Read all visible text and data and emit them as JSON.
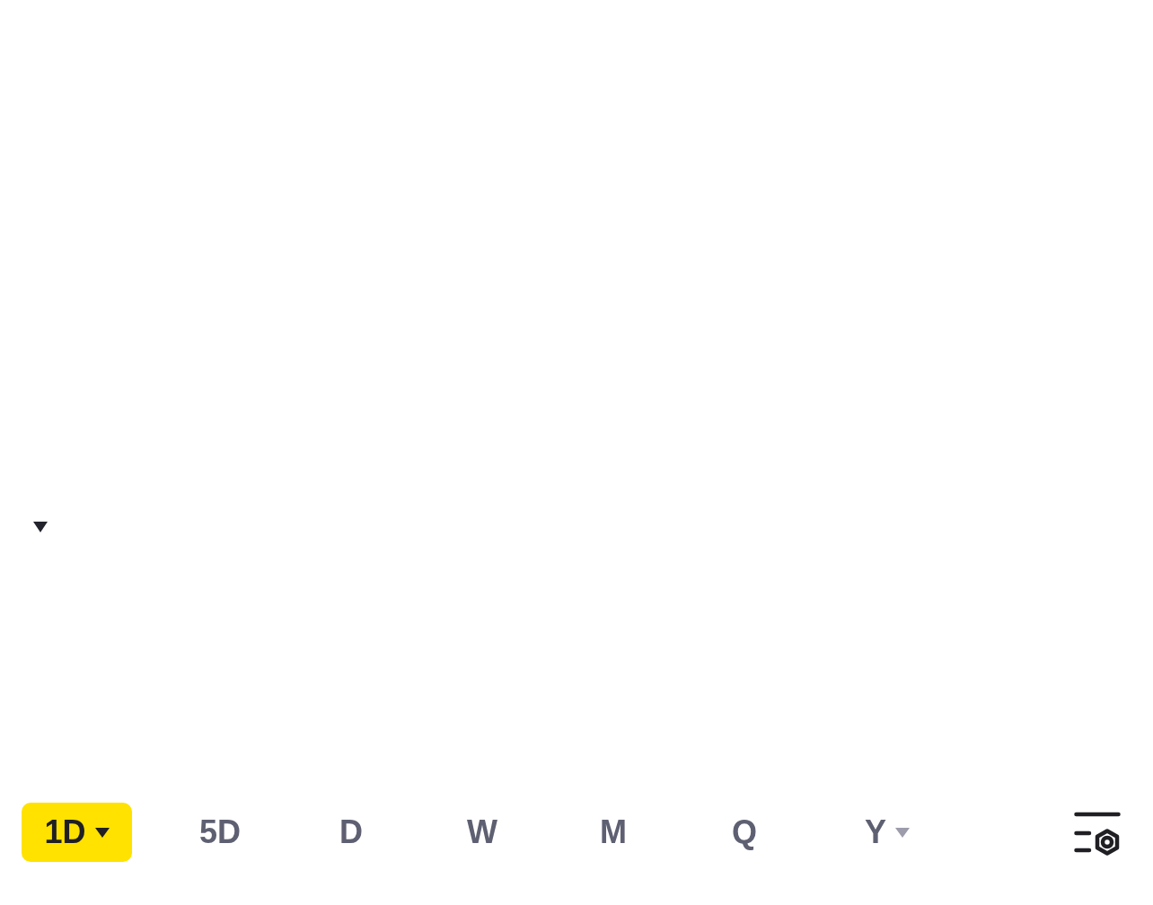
{
  "timeframe_tabs": [
    {
      "label": "1D",
      "selected": true,
      "dropdown": true
    },
    {
      "label": "5D",
      "selected": false,
      "dropdown": false
    },
    {
      "label": "D",
      "selected": false,
      "dropdown": false
    },
    {
      "label": "W",
      "selected": false,
      "dropdown": false
    },
    {
      "label": "M",
      "selected": false,
      "dropdown": false
    },
    {
      "label": "Q",
      "selected": false,
      "dropdown": false
    },
    {
      "label": "Y",
      "selected": false,
      "dropdown": true
    }
  ]
}
